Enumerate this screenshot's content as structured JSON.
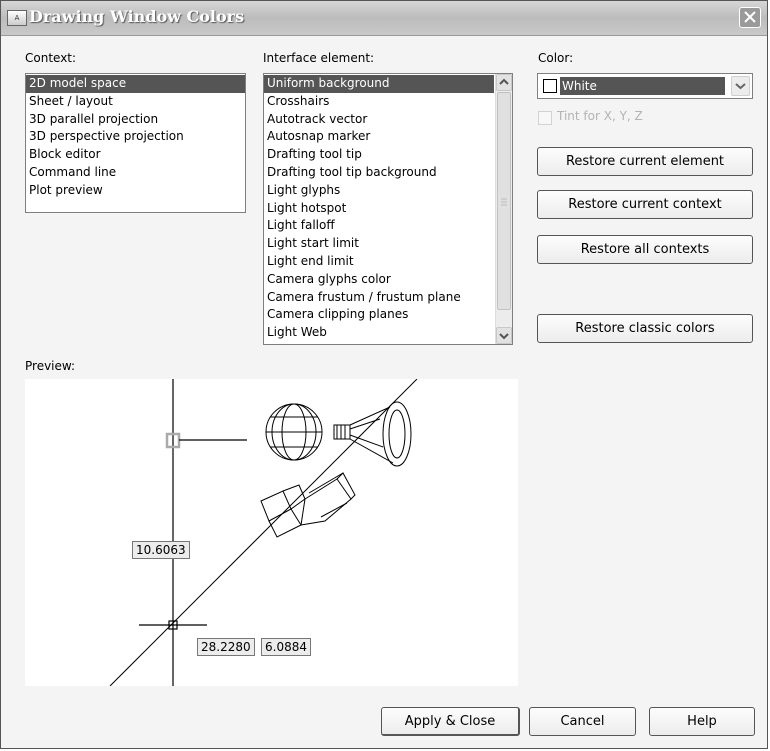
{
  "window": {
    "title": "Drawing Window Colors"
  },
  "context": {
    "label": "Context:",
    "items": [
      "2D model space",
      "Sheet / layout",
      "3D parallel projection",
      "3D perspective projection",
      "Block editor",
      "Command line",
      "Plot preview"
    ]
  },
  "interface_element": {
    "label": "Interface element:",
    "items": [
      "Uniform background",
      "Crosshairs",
      "Autotrack vector",
      "Autosnap marker",
      "Drafting tool tip",
      "Drafting tool tip background",
      "Light glyphs",
      "Light hotspot",
      "Light falloff",
      "Light start limit",
      "Light end limit",
      "Camera glyphs color",
      "Camera frustum / frustum plane",
      "Camera clipping planes",
      "Light Web"
    ]
  },
  "color": {
    "label": "Color:",
    "value": "White",
    "tint_label": "Tint for X, Y, Z"
  },
  "buttons": {
    "restore_element": "Restore current element",
    "restore_context": "Restore current context",
    "restore_all": "Restore all contexts",
    "restore_classic": "Restore classic colors",
    "apply_close": "Apply & Close",
    "cancel": "Cancel",
    "help": "Help"
  },
  "preview": {
    "label": "Preview:",
    "dim_vertical": "10.6063",
    "dim_distance": "28.2280",
    "dim_angle": "6.0884"
  }
}
